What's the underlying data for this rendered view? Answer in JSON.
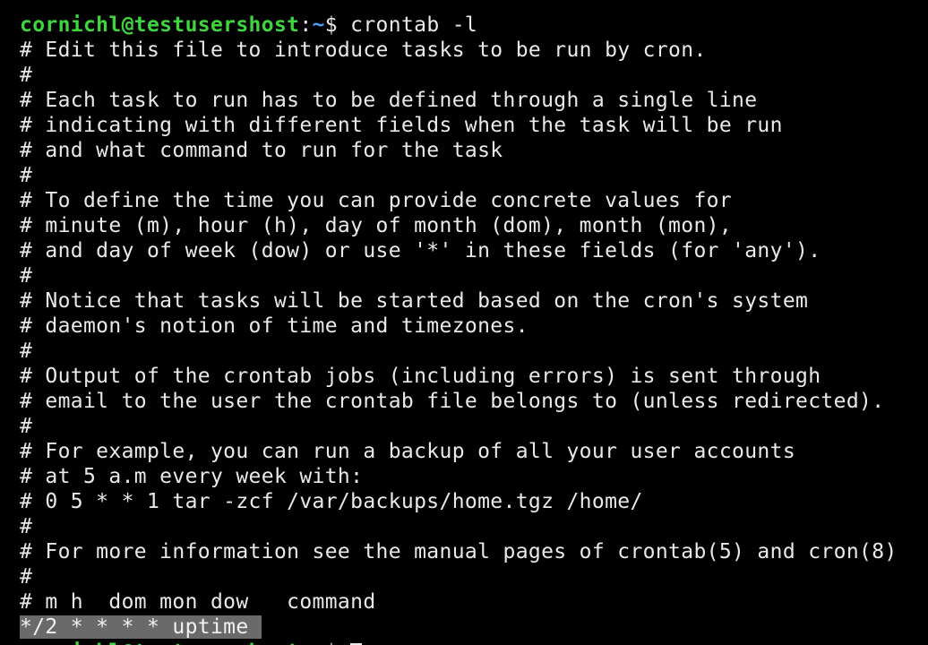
{
  "prompt": {
    "user_host": "cornichl@testusershost",
    "separator": ":",
    "path": "~",
    "symbol": "$ "
  },
  "command": "crontab -l",
  "comment_lines": [
    "# Edit this file to introduce tasks to be run by cron.",
    "#",
    "# Each task to run has to be defined through a single line",
    "# indicating with different fields when the task will be run",
    "# and what command to run for the task",
    "#",
    "# To define the time you can provide concrete values for",
    "# minute (m), hour (h), day of month (dom), month (mon),",
    "# and day of week (dow) or use '*' in these fields (for 'any').",
    "#",
    "# Notice that tasks will be started based on the cron's system",
    "# daemon's notion of time and timezones.",
    "#",
    "# Output of the crontab jobs (including errors) is sent through",
    "# email to the user the crontab file belongs to (unless redirected).",
    "#",
    "# For example, you can run a backup of all your user accounts",
    "# at 5 a.m every week with:",
    "# 0 5 * * 1 tar -zcf /var/backups/home.tgz /home/",
    "#",
    "# For more information see the manual pages of crontab(5) and cron(8)",
    "#",
    "# m h  dom mon dow   command"
  ],
  "cron_entry": "*/2 * * * * uptime ",
  "colors": {
    "background": "#000000",
    "text": "#e9e9e9",
    "user_host": "#3ed53e",
    "path": "#4aa0f0",
    "selection": "#6a6a6a"
  }
}
